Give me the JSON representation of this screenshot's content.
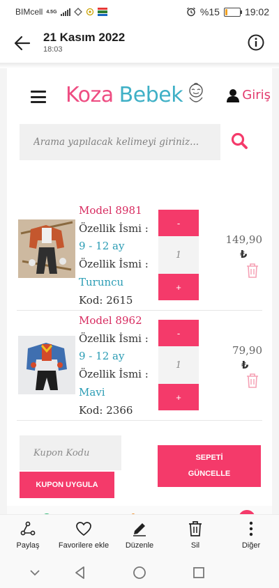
{
  "status_bar": {
    "carrier": "BIMcell",
    "network": "4.5G",
    "battery": "%15",
    "battery_level": 0.15,
    "time": "19:02"
  },
  "header": {
    "title": "21 Kasım 2022",
    "subtitle": "18:03"
  },
  "site": {
    "logo_part1": "Koza",
    "logo_part2": "Bebek",
    "login_label": "Giriş",
    "search_placeholder": "Arama yapılacak kelimeyi giriniz..."
  },
  "cart": {
    "items": [
      {
        "model": "Model 8981",
        "attr1_label": "Özellik İsmi :",
        "attr1_value": "9 - 12 ay",
        "attr2_label": "Özellik İsmi :",
        "attr2_value": "Turuncu",
        "code": "Kod: 2615",
        "quantity": "1",
        "minus": "-",
        "plus": "+",
        "price": "149,90",
        "currency": "₺"
      },
      {
        "model": "Model 8962",
        "attr1_label": "Özellik İsmi :",
        "attr1_value": "9 - 12 ay",
        "attr2_label": "Özellik İsmi :",
        "attr2_value": "Mavi",
        "code": "Kod: 2366",
        "quantity": "1",
        "minus": "-",
        "plus": "+",
        "price": "79,90",
        "currency": "₺"
      }
    ],
    "coupon_placeholder": "Kupon Kodu",
    "coupon_button": "KUPON UYGULA",
    "update_button_line1": "SEPETİ",
    "update_button_line2": "GÜNCELLE"
  },
  "actions": {
    "share": "Paylaş",
    "favorite": "Favorilere ekle",
    "edit": "Düzenle",
    "delete": "Sil",
    "more": "Diğer"
  },
  "colors": {
    "accent": "#f43a6a",
    "brand_pink": "#ee4d82",
    "brand_blue": "#3fb0c6"
  }
}
